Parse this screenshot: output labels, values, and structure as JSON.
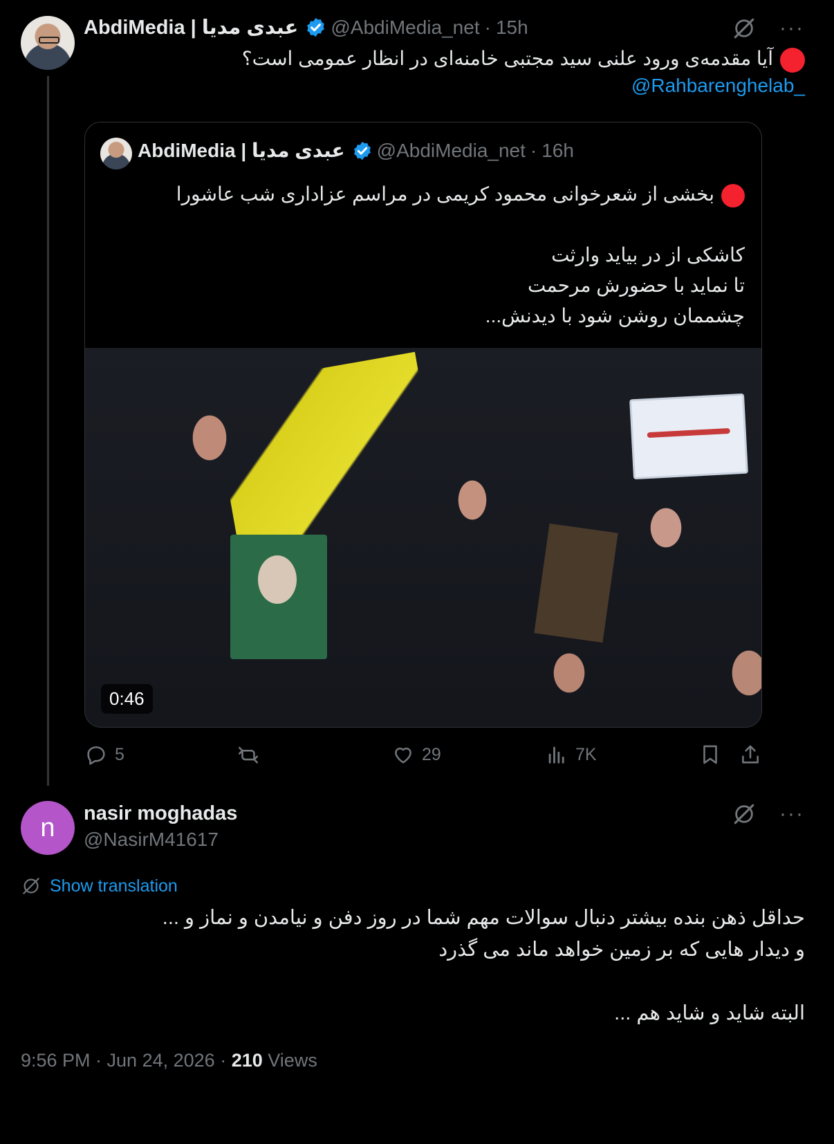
{
  "tweet": {
    "author_name": "AbdiMedia | عبدی مدیا",
    "handle": "@AbdiMedia_net",
    "time": "15h",
    "text": "آیا مقدمه‌ی ورود علنی سید مجتبی خامنه‌ای در انظار عمومی است؟",
    "mention": "@Rahbarenghelab_"
  },
  "quote": {
    "author_name": "AbdiMedia | عبدی مدیا",
    "handle": "@AbdiMedia_net",
    "time": "16h",
    "lines": [
      "بخشی از شعرخوانی محمود کریمی در مراسم عزاداری شب عاشورا",
      "",
      "کاشکی از در بیاید وارثت",
      "تا نماید با حضورش مرحمت",
      "چشممان روشن شود با دیدنش..."
    ],
    "video_duration": "0:46"
  },
  "actions": {
    "replies": "5",
    "likes": "29",
    "views": "7K"
  },
  "reply": {
    "avatar_letter": "n",
    "author_name": "nasir moghadas",
    "handle": "@NasirM41617",
    "show_translation": "Show translation",
    "lines": [
      "حداقل ذهن بنده بیشتر دنبال سوالات مهم شما در روز دفن و نیامدن و نماز و ...",
      "و دیدار هایی که بر زمین خواهد ماند می گذرد",
      "",
      "البته شاید و شاید هم ..."
    ],
    "timestamp": "9:56 PM · Jun 24, 2026",
    "views_count": "210",
    "views_label": "Views"
  },
  "icons": {
    "verified": "verified-badge-icon",
    "grok": "grok-icon",
    "more": "more-icon",
    "reply": "reply-icon",
    "retweet": "retweet-icon",
    "like": "heart-icon",
    "views": "views-icon",
    "bookmark": "bookmark-icon",
    "share": "share-icon",
    "translate": "translate-icon"
  },
  "colors": {
    "background": "#000000",
    "text": "#e7e9ea",
    "muted": "#71767b",
    "link": "#1d9bf0",
    "red_dot": "#f4212e",
    "reply_avatar": "#b455c9"
  }
}
